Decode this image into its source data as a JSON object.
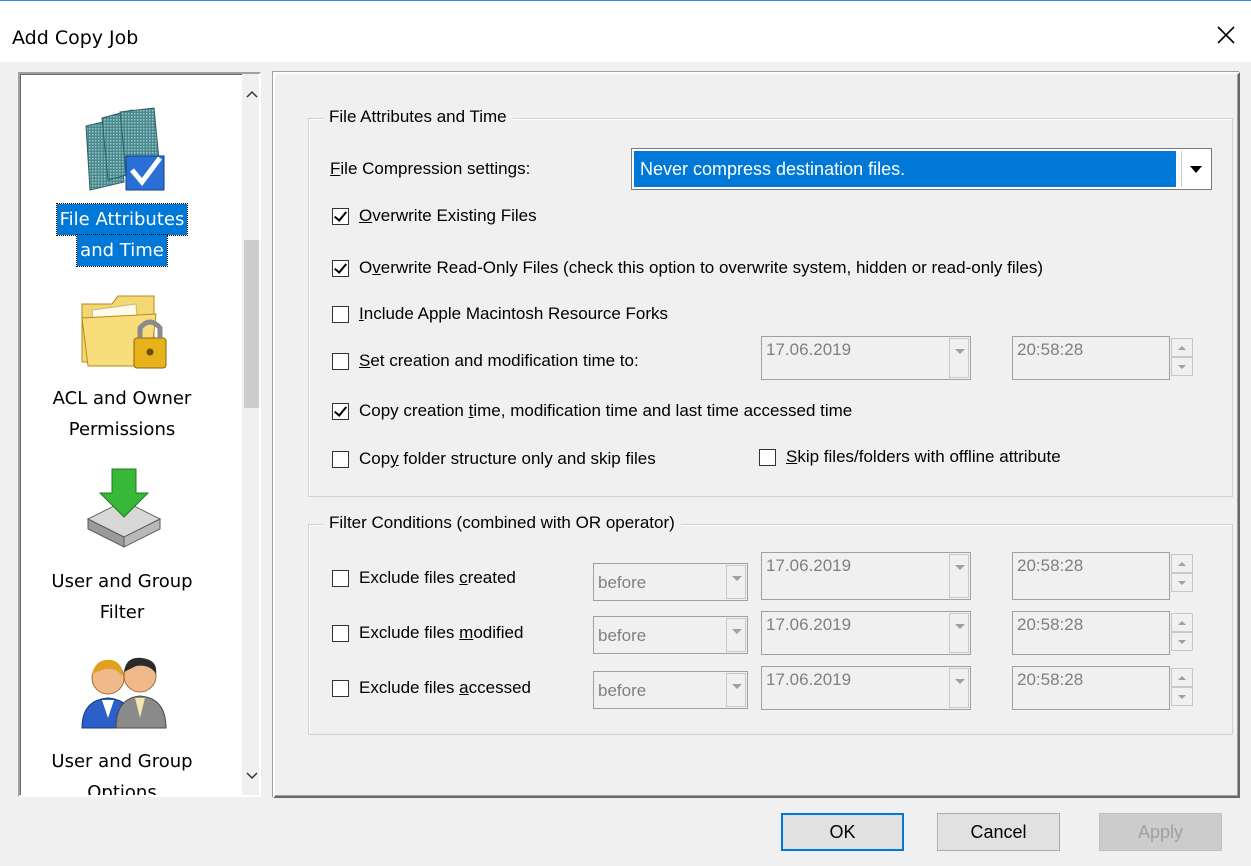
{
  "window": {
    "title": "Add Copy Job"
  },
  "sidebar": {
    "items": [
      {
        "line1": "File Attributes",
        "line2": "and Time",
        "icon": "file-attributes-icon",
        "selected": true
      },
      {
        "line1": "ACL and Owner",
        "line2": "Permissions",
        "icon": "acl-folder-lock-icon",
        "selected": false
      },
      {
        "line1": "User and Group",
        "line2": "Filter",
        "icon": "user-group-filter-icon",
        "selected": false
      },
      {
        "line1": "User and Group",
        "line2": "Options",
        "icon": "user-group-options-icon",
        "selected": false
      }
    ]
  },
  "file_attributes": {
    "legend": "File Attributes and Time",
    "compression_label_first": "F",
    "compression_label_rest": "ile Compression settings:",
    "compression_value": "Never compress destination files.",
    "overwrite_existing": {
      "u": "O",
      "rest": "verwrite Existing Files",
      "checked": true
    },
    "overwrite_readonly": {
      "pre": "O",
      "u": "v",
      "rest": "erwrite Read-Only Files (check this option to overwrite system, hidden or read-only files)",
      "checked": true
    },
    "include_apple": {
      "u": "I",
      "rest": "nclude Apple Macintosh Resource Forks",
      "checked": false
    },
    "set_time": {
      "u": "S",
      "rest": "et creation and modification time to:",
      "checked": false,
      "date": "17.06.2019",
      "time": "20:58:28"
    },
    "copy_times": {
      "pre": "Copy creation ",
      "u": "t",
      "rest": "ime, modification time and last time accessed time",
      "checked": true
    },
    "copy_folder": {
      "pre": "Cop",
      "u": "y",
      "rest": " folder structure only and skip files",
      "checked": false
    },
    "skip_offline": {
      "u": "S",
      "rest": "kip files/folders with offline attribute",
      "checked": false
    }
  },
  "filter_conditions": {
    "legend": "Filter Conditions (combined with OR operator)",
    "rows": [
      {
        "pre": "Exclude files ",
        "u": "c",
        "rest": "reated",
        "op": "before",
        "date": "17.06.2019",
        "time": "20:58:28",
        "checked": false
      },
      {
        "pre": "Exclude files ",
        "u": "m",
        "rest": "odified",
        "op": "before",
        "date": "17.06.2019",
        "time": "20:58:28",
        "checked": false
      },
      {
        "pre": "Exclude files ",
        "u": "a",
        "rest": "ccessed",
        "op": "before",
        "date": "17.06.2019",
        "time": "20:58:28",
        "checked": false
      }
    ]
  },
  "buttons": {
    "ok": "OK",
    "cancel": "Cancel",
    "apply": "Apply"
  },
  "colors": {
    "accent": "#0078d7",
    "disabled_text": "#808080"
  }
}
